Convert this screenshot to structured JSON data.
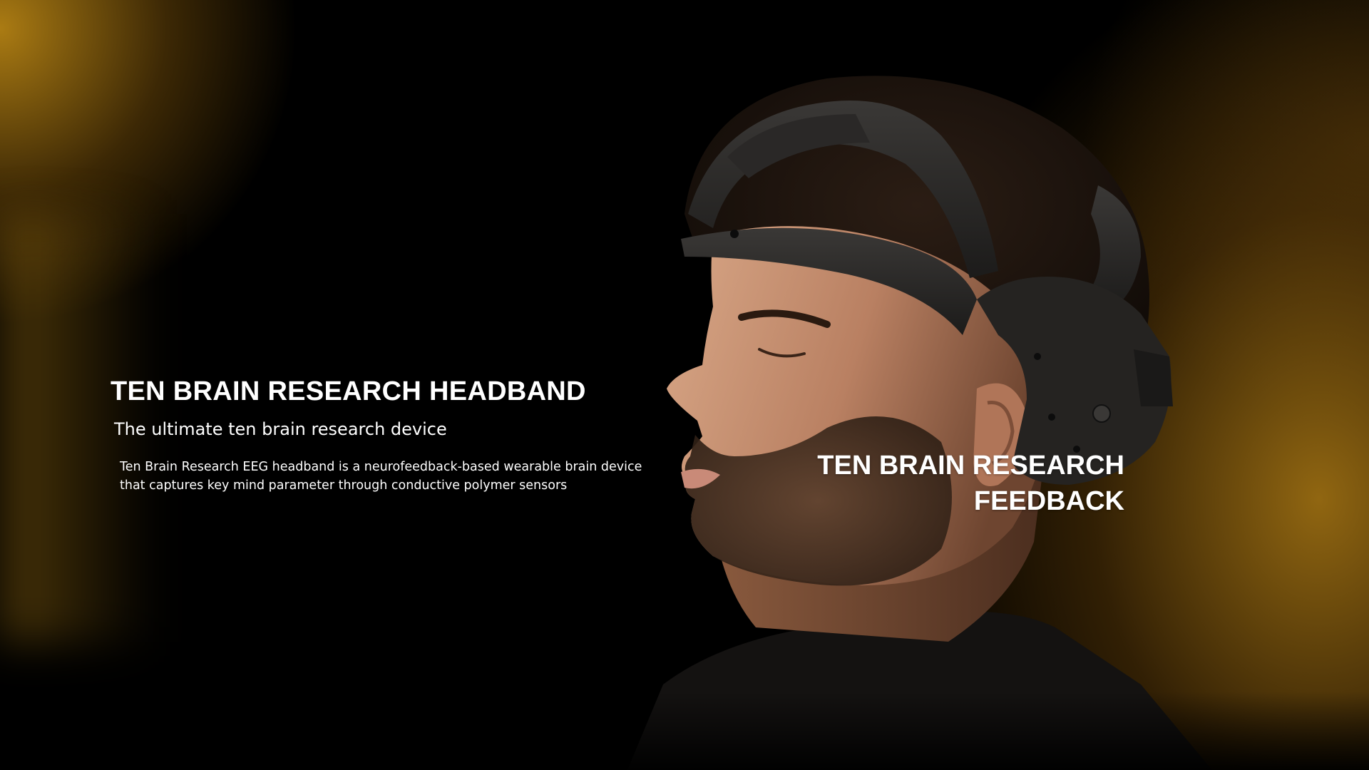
{
  "hero": {
    "headline": "TEN BRAIN RESEARCH HEADBAND",
    "subtitle": "The ultimate ten brain research device",
    "description_lines": [
      "Ten Brain Research EEG headband is a neurofeedback-based wearable brain device",
      "that captures key mind parameter through conductive polymer sensors"
    ]
  },
  "overlay": {
    "title_lines": [
      "TEN BRAIN RESEARCH",
      "FEEDBACK"
    ]
  },
  "image": {
    "subject": "man-wearing-eeg-headband-icon"
  },
  "colors": {
    "background": "#000000",
    "accent_gold": "#b4821a",
    "text": "#ffffff"
  }
}
